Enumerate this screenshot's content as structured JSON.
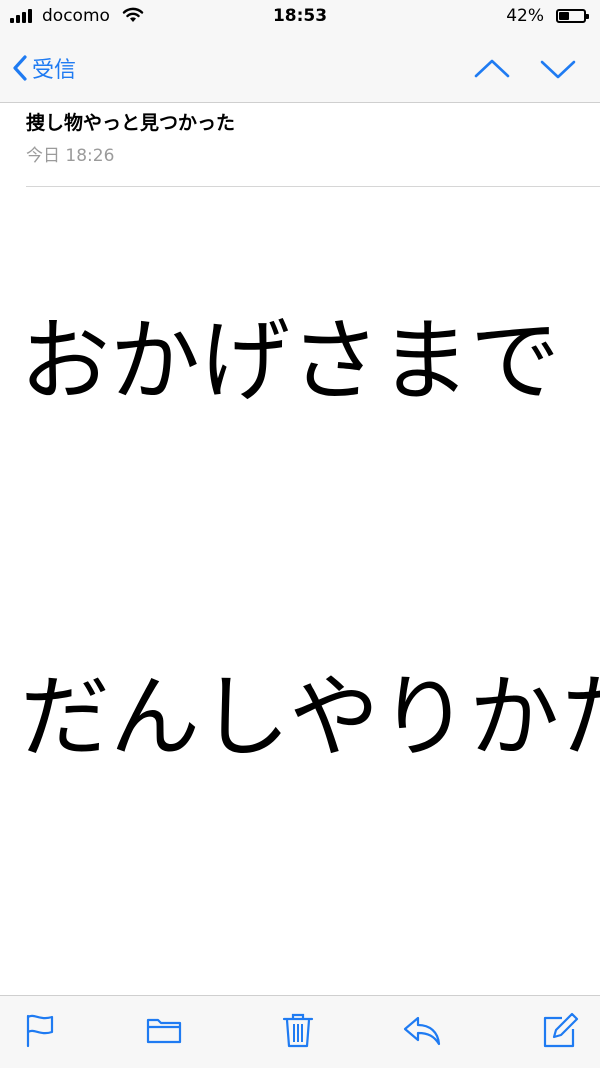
{
  "status_bar": {
    "carrier": "docomo",
    "time": "18:53",
    "battery_percent": "42%",
    "battery_level": 0.42
  },
  "nav": {
    "back_label": "受信",
    "accent_color": "#1f7bf2"
  },
  "message": {
    "subject": "捜し物やっと見つかった",
    "date": "今日 18:26",
    "body_lines": [
      "おかげさまで",
      "だんしやりかた"
    ]
  },
  "toolbar": {
    "icons": [
      "flag-icon",
      "folder-icon",
      "trash-icon",
      "reply-icon",
      "compose-icon"
    ]
  }
}
